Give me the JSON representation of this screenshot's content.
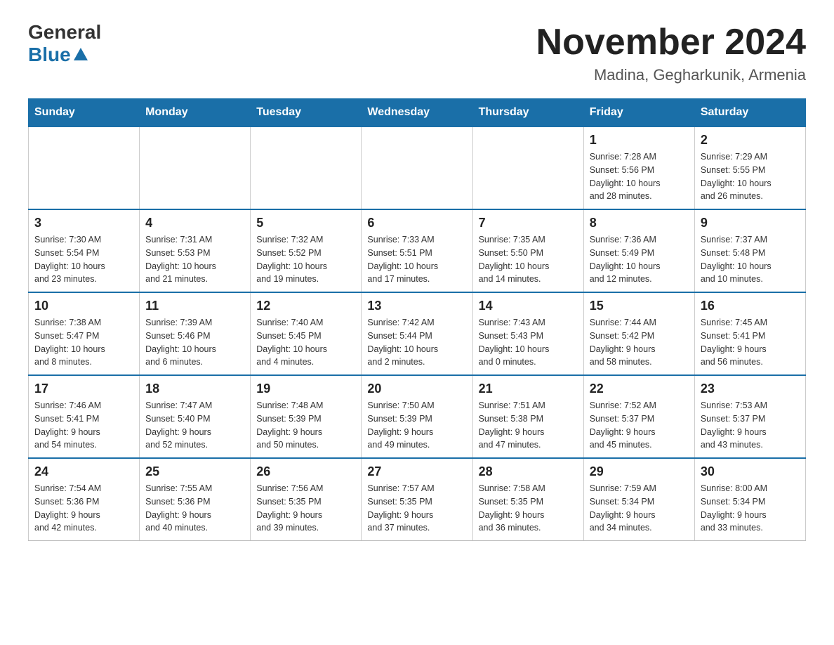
{
  "header": {
    "logo_general": "General",
    "logo_blue": "Blue",
    "month_title": "November 2024",
    "location": "Madina, Gegharkunik, Armenia"
  },
  "weekdays": [
    "Sunday",
    "Monday",
    "Tuesday",
    "Wednesday",
    "Thursday",
    "Friday",
    "Saturday"
  ],
  "weeks": [
    [
      {
        "day": "",
        "info": ""
      },
      {
        "day": "",
        "info": ""
      },
      {
        "day": "",
        "info": ""
      },
      {
        "day": "",
        "info": ""
      },
      {
        "day": "",
        "info": ""
      },
      {
        "day": "1",
        "info": "Sunrise: 7:28 AM\nSunset: 5:56 PM\nDaylight: 10 hours\nand 28 minutes."
      },
      {
        "day": "2",
        "info": "Sunrise: 7:29 AM\nSunset: 5:55 PM\nDaylight: 10 hours\nand 26 minutes."
      }
    ],
    [
      {
        "day": "3",
        "info": "Sunrise: 7:30 AM\nSunset: 5:54 PM\nDaylight: 10 hours\nand 23 minutes."
      },
      {
        "day": "4",
        "info": "Sunrise: 7:31 AM\nSunset: 5:53 PM\nDaylight: 10 hours\nand 21 minutes."
      },
      {
        "day": "5",
        "info": "Sunrise: 7:32 AM\nSunset: 5:52 PM\nDaylight: 10 hours\nand 19 minutes."
      },
      {
        "day": "6",
        "info": "Sunrise: 7:33 AM\nSunset: 5:51 PM\nDaylight: 10 hours\nand 17 minutes."
      },
      {
        "day": "7",
        "info": "Sunrise: 7:35 AM\nSunset: 5:50 PM\nDaylight: 10 hours\nand 14 minutes."
      },
      {
        "day": "8",
        "info": "Sunrise: 7:36 AM\nSunset: 5:49 PM\nDaylight: 10 hours\nand 12 minutes."
      },
      {
        "day": "9",
        "info": "Sunrise: 7:37 AM\nSunset: 5:48 PM\nDaylight: 10 hours\nand 10 minutes."
      }
    ],
    [
      {
        "day": "10",
        "info": "Sunrise: 7:38 AM\nSunset: 5:47 PM\nDaylight: 10 hours\nand 8 minutes."
      },
      {
        "day": "11",
        "info": "Sunrise: 7:39 AM\nSunset: 5:46 PM\nDaylight: 10 hours\nand 6 minutes."
      },
      {
        "day": "12",
        "info": "Sunrise: 7:40 AM\nSunset: 5:45 PM\nDaylight: 10 hours\nand 4 minutes."
      },
      {
        "day": "13",
        "info": "Sunrise: 7:42 AM\nSunset: 5:44 PM\nDaylight: 10 hours\nand 2 minutes."
      },
      {
        "day": "14",
        "info": "Sunrise: 7:43 AM\nSunset: 5:43 PM\nDaylight: 10 hours\nand 0 minutes."
      },
      {
        "day": "15",
        "info": "Sunrise: 7:44 AM\nSunset: 5:42 PM\nDaylight: 9 hours\nand 58 minutes."
      },
      {
        "day": "16",
        "info": "Sunrise: 7:45 AM\nSunset: 5:41 PM\nDaylight: 9 hours\nand 56 minutes."
      }
    ],
    [
      {
        "day": "17",
        "info": "Sunrise: 7:46 AM\nSunset: 5:41 PM\nDaylight: 9 hours\nand 54 minutes."
      },
      {
        "day": "18",
        "info": "Sunrise: 7:47 AM\nSunset: 5:40 PM\nDaylight: 9 hours\nand 52 minutes."
      },
      {
        "day": "19",
        "info": "Sunrise: 7:48 AM\nSunset: 5:39 PM\nDaylight: 9 hours\nand 50 minutes."
      },
      {
        "day": "20",
        "info": "Sunrise: 7:50 AM\nSunset: 5:39 PM\nDaylight: 9 hours\nand 49 minutes."
      },
      {
        "day": "21",
        "info": "Sunrise: 7:51 AM\nSunset: 5:38 PM\nDaylight: 9 hours\nand 47 minutes."
      },
      {
        "day": "22",
        "info": "Sunrise: 7:52 AM\nSunset: 5:37 PM\nDaylight: 9 hours\nand 45 minutes."
      },
      {
        "day": "23",
        "info": "Sunrise: 7:53 AM\nSunset: 5:37 PM\nDaylight: 9 hours\nand 43 minutes."
      }
    ],
    [
      {
        "day": "24",
        "info": "Sunrise: 7:54 AM\nSunset: 5:36 PM\nDaylight: 9 hours\nand 42 minutes."
      },
      {
        "day": "25",
        "info": "Sunrise: 7:55 AM\nSunset: 5:36 PM\nDaylight: 9 hours\nand 40 minutes."
      },
      {
        "day": "26",
        "info": "Sunrise: 7:56 AM\nSunset: 5:35 PM\nDaylight: 9 hours\nand 39 minutes."
      },
      {
        "day": "27",
        "info": "Sunrise: 7:57 AM\nSunset: 5:35 PM\nDaylight: 9 hours\nand 37 minutes."
      },
      {
        "day": "28",
        "info": "Sunrise: 7:58 AM\nSunset: 5:35 PM\nDaylight: 9 hours\nand 36 minutes."
      },
      {
        "day": "29",
        "info": "Sunrise: 7:59 AM\nSunset: 5:34 PM\nDaylight: 9 hours\nand 34 minutes."
      },
      {
        "day": "30",
        "info": "Sunrise: 8:00 AM\nSunset: 5:34 PM\nDaylight: 9 hours\nand 33 minutes."
      }
    ]
  ]
}
